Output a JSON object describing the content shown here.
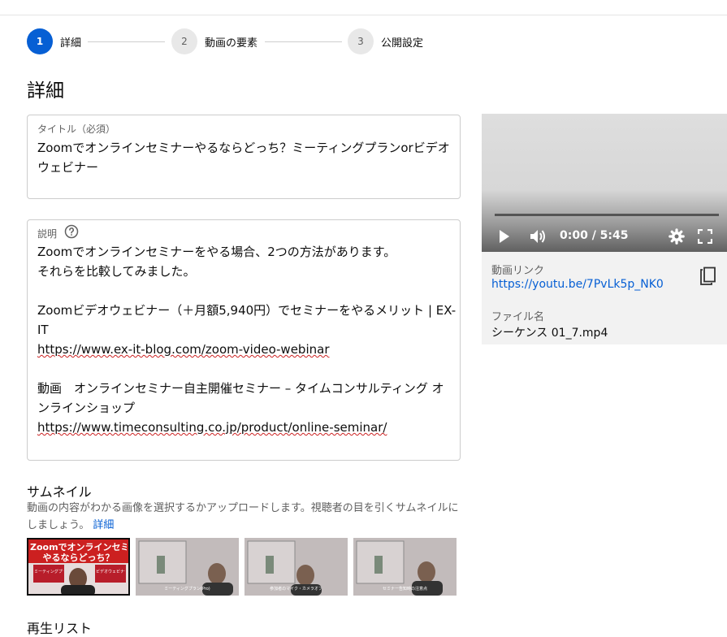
{
  "stepper": {
    "steps": [
      {
        "num": "1",
        "label": "詳細"
      },
      {
        "num": "2",
        "label": "動画の要素"
      },
      {
        "num": "3",
        "label": "公開設定"
      }
    ]
  },
  "page_title": "詳細",
  "title_field": {
    "label": "タイトル（必須）",
    "lines": [
      "Zoomでオンラインセミナーやるならどっち？ミーティングプランorビデオ",
      "ウェビナー"
    ]
  },
  "description_field": {
    "label": "説明",
    "lines": [
      "Zoomでオンラインセミナーをやる場合、2つの方法があります。",
      "それらを比較してみました。",
      "",
      "Zoomビデオウェビナー（＋月額5,940円）でセミナーをやるメリット | EX-",
      "IT",
      "https://www.ex-it-blog.com/zoom-video-webinar",
      "",
      "動画　オンラインセミナー自主開催セミナー – タイムコンサルティング オ",
      "ンラインショップ",
      "https://www.timeconsulting.co.jp/product/online-seminar/"
    ]
  },
  "thumbnails": {
    "title": "サムネイル",
    "desc": "動画の内容がわかる画像を選択するかアップロードします。視聴者の目を引くサムネイルにしましょう。",
    "learn_more": "詳細",
    "items": [
      {
        "line1": "Zoomでオンラインセミナー",
        "line2": "やるならどっち？",
        "tag_left": "ミーティングプラン",
        "tag_right": "ビデオウェビナー"
      },
      {
        "caption": "ミーティングプラン(Pro)"
      },
      {
        "caption": "参加者のマイク・カメラオフ"
      },
      {
        "caption": "セミナー告知時の注意点"
      }
    ]
  },
  "next_section": "再生リスト",
  "player": {
    "time": "0:00 / 5:45",
    "link_label": "動画リンク",
    "link": "https://youtu.be/7PvLk5p_NK0",
    "file_label": "ファイル名",
    "file": "シーケンス 01_7.mp4"
  }
}
